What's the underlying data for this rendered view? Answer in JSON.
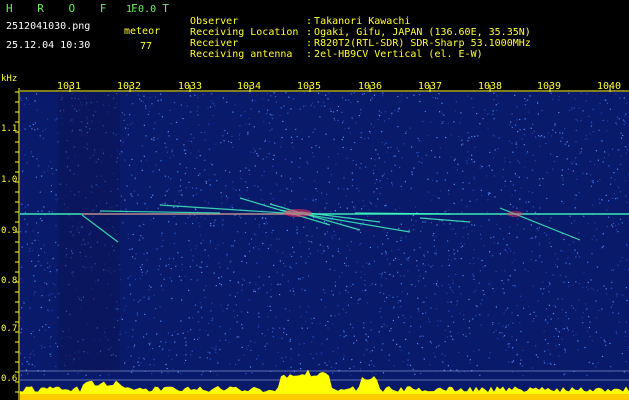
{
  "app": {
    "name": "H R O F F T",
    "version": "1.0.0"
  },
  "capture": {
    "filename": "2512041030.png",
    "timestamp": "25.12.04 10:30",
    "mode_label": "meteor",
    "meteor_count": "77"
  },
  "station": {
    "rows": [
      {
        "label": "Observer",
        "value": "Takanori Kawachi"
      },
      {
        "label": "Receiving Location",
        "value": "Ogaki, Gifu, JAPAN (136.60E, 35.35N)"
      },
      {
        "label": "Receiver",
        "value": "R820T2(RTL-SDR) SDR-Sharp 53.1000MHz"
      },
      {
        "label": "Receiving antenna",
        "value": "2el-HB9CV Vertical (el. E-W)"
      }
    ]
  },
  "spectrogram": {
    "y_unit": "kHz",
    "y_ticks": [
      "1.1",
      "1.0",
      "0.9",
      "0.8",
      "0.7",
      "0.6"
    ],
    "x_ticks": [
      "1031",
      "1032",
      "1033",
      "1034",
      "1035",
      "1036",
      "1037",
      "1038",
      "1039",
      "1040"
    ],
    "colors": {
      "background": "#0a1a6a",
      "noise": "#2a5ad0",
      "carrier": "#40ffc0",
      "hot": "#ff3060",
      "axis": "#ffff33",
      "spectrum": "#ffff00"
    }
  }
}
